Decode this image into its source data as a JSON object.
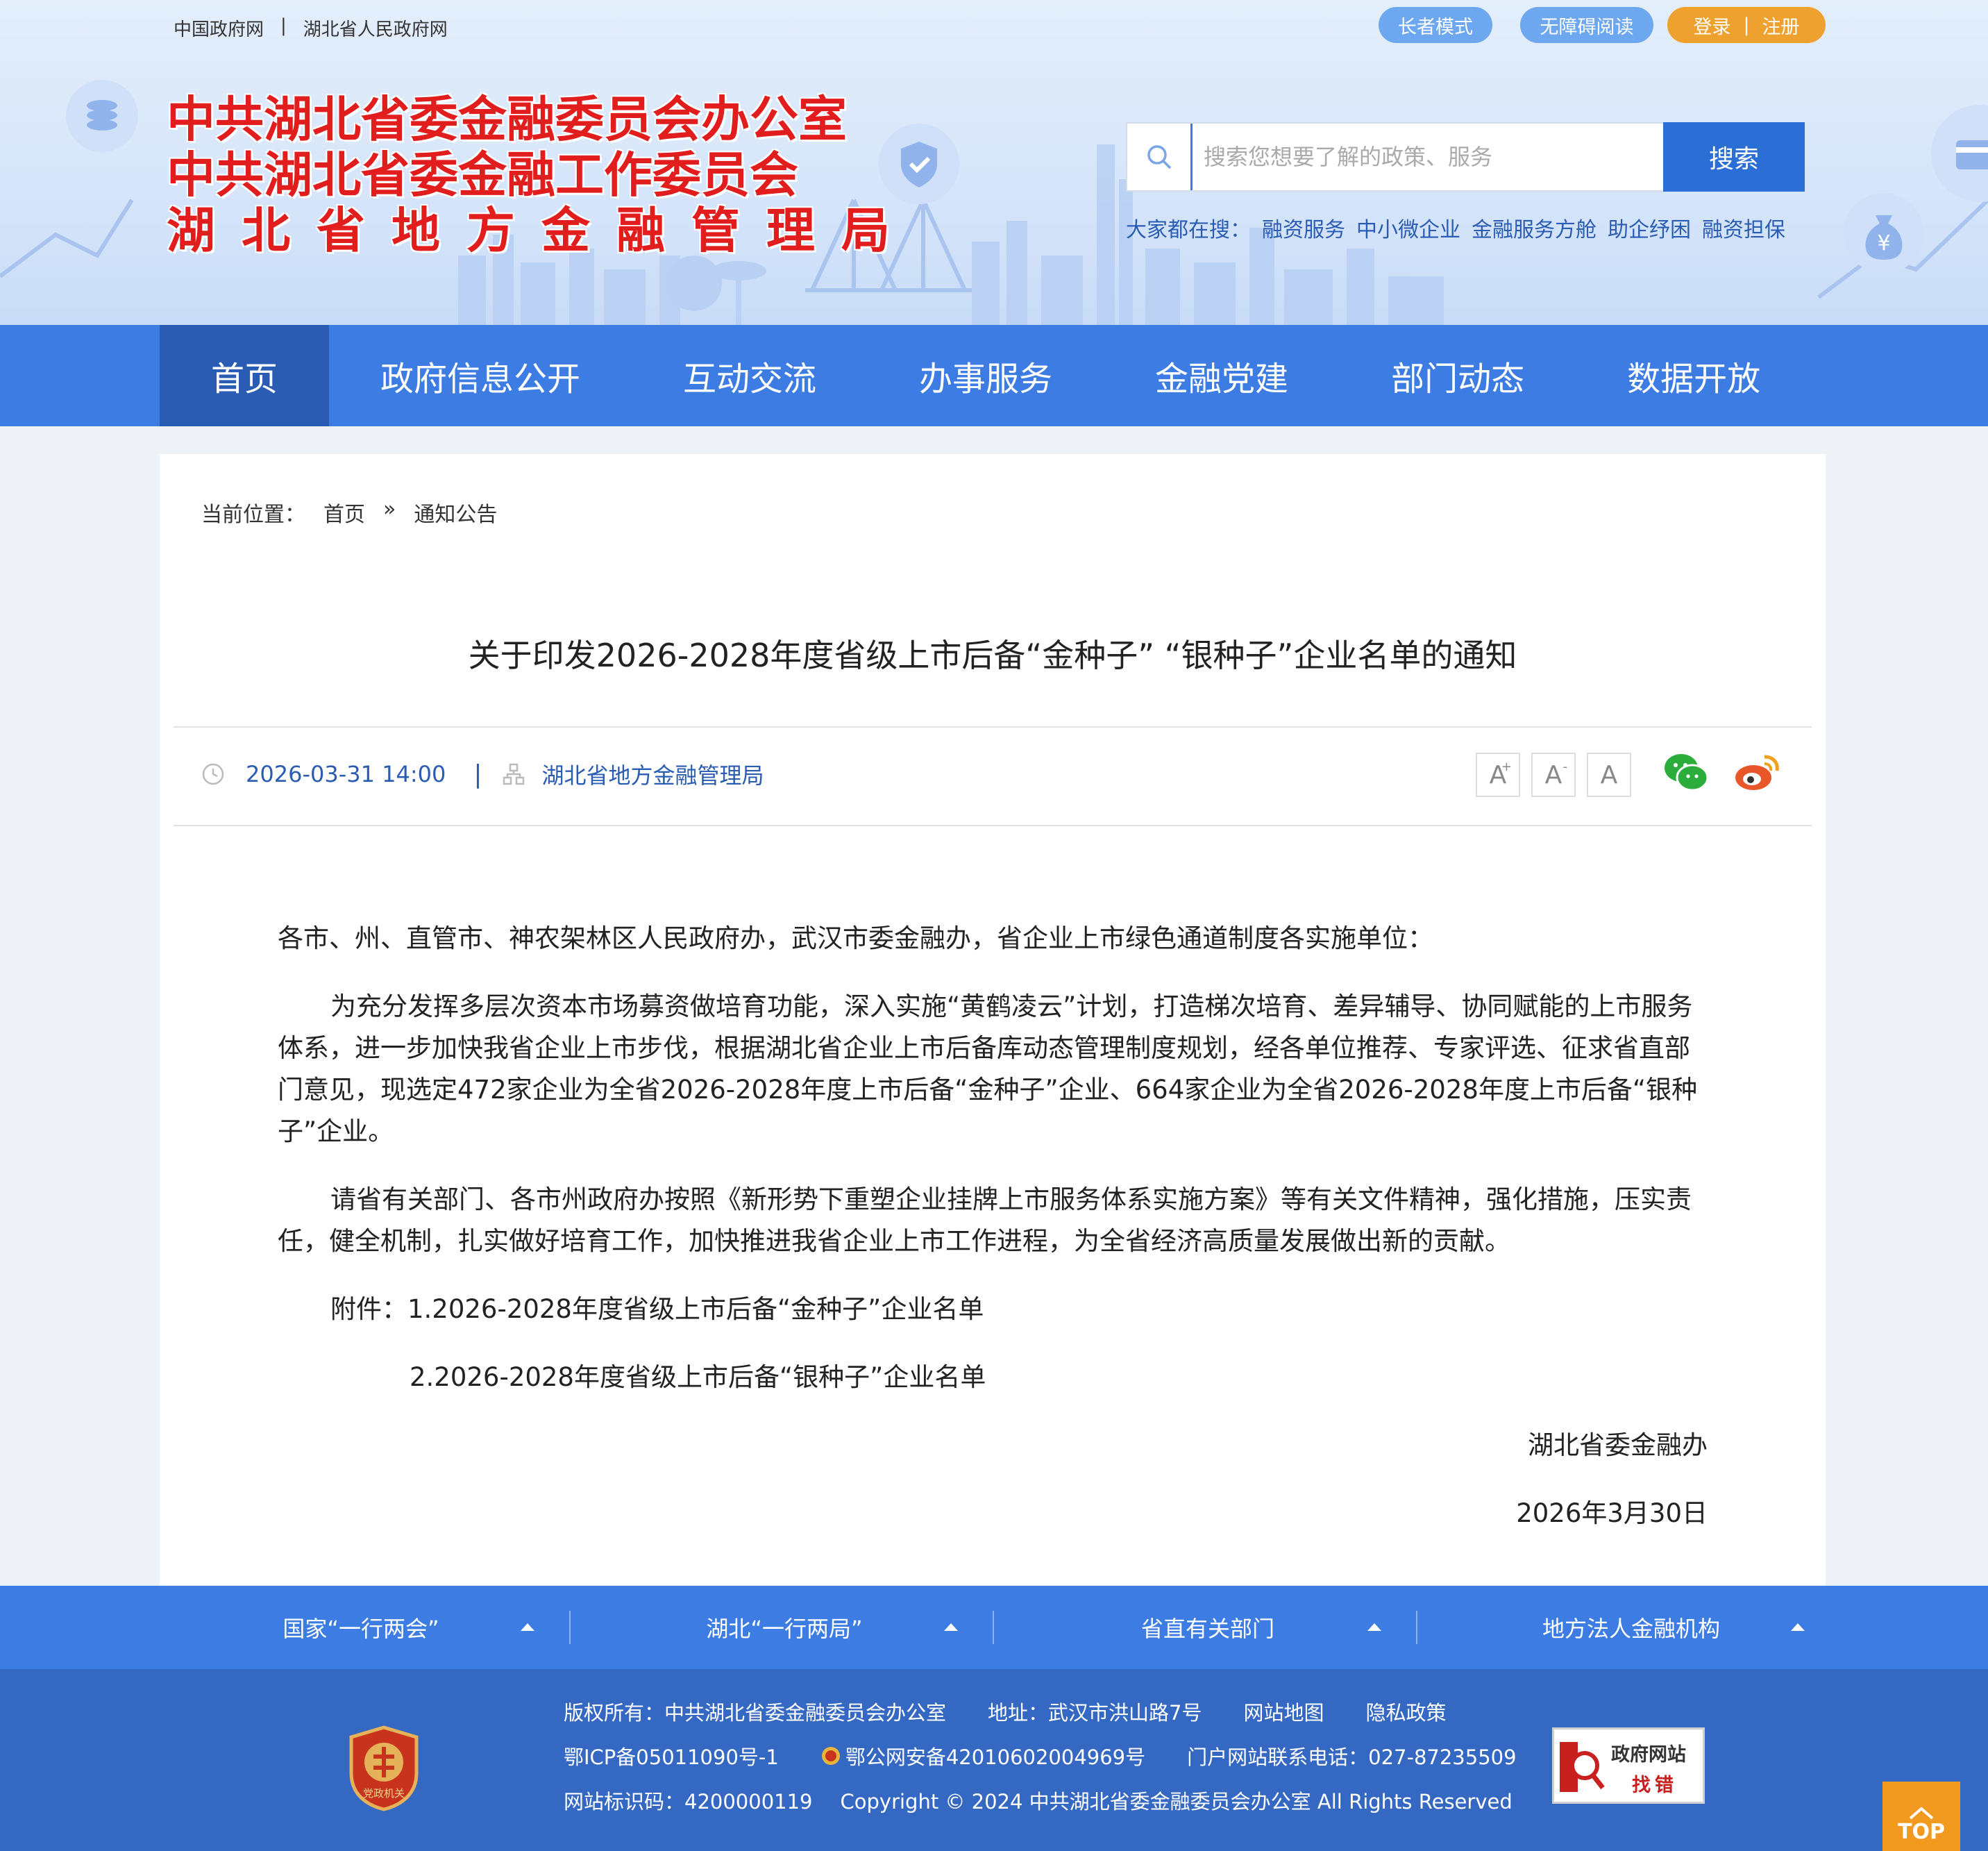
{
  "top_links": [
    "中国政府网",
    "|",
    "湖北省人民政府网"
  ],
  "top_buttons": {
    "elder": "长者模式",
    "access": "无障碍阅读",
    "login": "登录",
    "login_sep": "|",
    "register": "注册"
  },
  "logo": {
    "line1": "中共湖北省委金融委员会办公室",
    "line2": "中共湖北省委金融工作委员会",
    "line3": "湖北省地方金融管理局"
  },
  "search": {
    "placeholder": "搜索您想要了解的政策、服务",
    "button": "搜索"
  },
  "hot_search": {
    "label": "大家都在搜：",
    "items": [
      "融资服务",
      "中小微企业",
      "金融服务方舱",
      "助企纾困",
      "融资担保"
    ]
  },
  "nav": [
    "首页",
    "政府信息公开",
    "互动交流",
    "办事服务",
    "金融党建",
    "部门动态",
    "数据开放"
  ],
  "breadcrumb": {
    "label": "当前位置：",
    "home": "首页",
    "sep": "»",
    "current": "通知公告"
  },
  "article": {
    "title": "关于印发2026-2028年度省级上市后备“金种子” “银种子”企业名单的通知",
    "datetime": "2026-03-31 14:00",
    "meta_sep": "|",
    "source": "湖北省地方金融管理局",
    "font_sizes": [
      "A",
      "A",
      "A"
    ],
    "salutation": "各市、州、直管市、神农架林区人民政府办，武汉市委金融办，省企业上市绿色通道制度各实施单位：",
    "para1": "为充分发挥多层次资本市场募资做培育功能，深入实施“黄鹤凌云”计划，打造梯次培育、差异辅导、协同赋能的上市服务体系，进一步加快我省企业上市步伐，根据湖北省企业上市后备库动态管理制度规划，经各单位推荐、专家评选、征求省直部门意见，现选定472家企业为全省2026-2028年度上市后备“金种子”企业、664家企业为全省2026-2028年度上市后备“银种子”企业。",
    "para2": "请省有关部门、各市州政府办按照《新形势下重塑企业挂牌上市服务体系实施方案》等有关文件精神，强化措施，压实责任，健全机制，扎实做好培育工作，加快推进我省企业上市工作进程，为全省经济高质量发展做出新的贡献。",
    "attach1": "附件：1.2026-2028年度省级上市后备“金种子”企业名单",
    "attach2": "2.2026-2028年度省级上市后备“银种子”企业名单",
    "signer": "湖北省委金融办",
    "date": "2026年3月30日"
  },
  "footer_links": [
    "国家“一行两会”",
    "湖北“一行两局”",
    "省直有关部门",
    "地方法人金融机构"
  ],
  "footer": {
    "copyright": "版权所有：中共湖北省委金融委员会办公室",
    "address": "地址：武汉市洪山路7号",
    "sitemap": "网站地图",
    "privacy": "隐私政策",
    "icp": "鄂ICP备05011090号-1",
    "police": "鄂公网安备42010602004969号",
    "phone": "门户网站联系电话：027-87235509",
    "site_id": "网站标识码：4200000119",
    "rights": "Copyright © 2024 中共湖北省委金融委员会办公室 All Rights Reserved",
    "badge_text": "党政机关",
    "zhaocuo_line1": "政府网站",
    "zhaocuo_line2": "找错"
  },
  "top_button": "TOP",
  "colors": {
    "nav_blue": "#3d7de3",
    "nav_active": "#2a5cb3",
    "footer_blue": "#3468c2",
    "logo_red": "#e21d1d",
    "login_orange": "#eea12f"
  }
}
